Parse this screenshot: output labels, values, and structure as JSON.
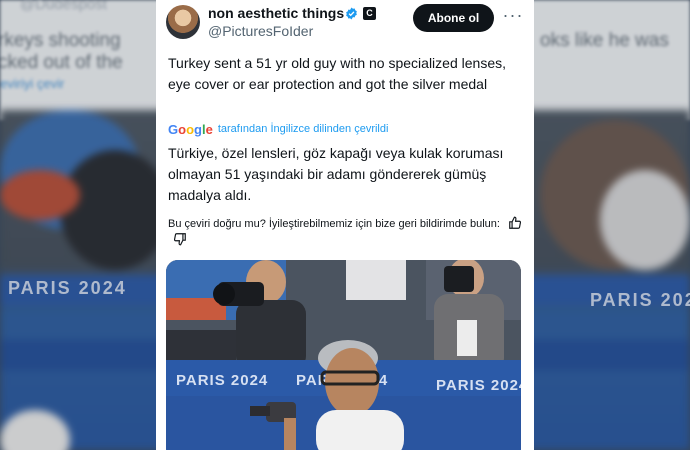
{
  "background": {
    "ghost_handle": "@Dudespost",
    "ghost_left_line1": "rkeys shooting",
    "ghost_left_line2": "cked out of the",
    "ghost_right_line": "oks like he was",
    "ghost_translate_link": "eviriyi çevir",
    "brand": "PARIS 2024"
  },
  "tweet": {
    "author_name": "non aesthetic things",
    "handle": "@PicturesFoIder",
    "follow_label": "Abone ol",
    "more_icon": "more-horizontal-icon",
    "text": "Turkey sent a 51 yr old guy with no specialized lenses, eye cover or ear protection and got the silver medal",
    "translated_by_logo": "Google",
    "translated_by_note": "tarafından İngilizce dilinden çevrildi",
    "translated_text": "Türkiye, özel lensleri, göz kapağı veya kulak koruması olmayan 51 yaşındaki bir adamı göndererek gümüş madalya aldı.",
    "feedback_prompt": "Bu çeviri doğru mu? İyileştirebilmemiz için bize geri bildirimde bulun:",
    "media_brand": "PARIS 2024"
  },
  "colors": {
    "verified": "#1d9bf0",
    "link": "#1d9bf0",
    "text": "#0f1419",
    "secondary": "#536471",
    "button": "#0f1419",
    "board_blue": "#2b5aa8"
  }
}
